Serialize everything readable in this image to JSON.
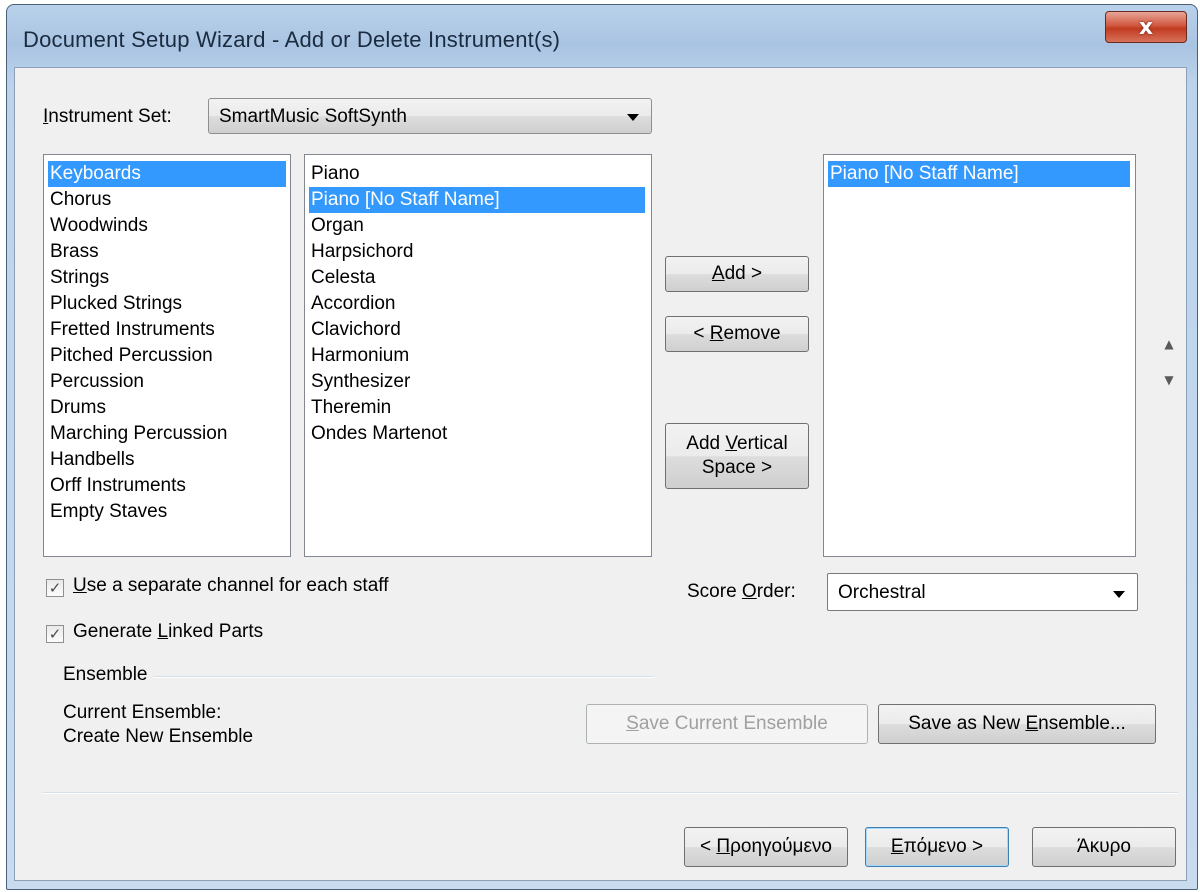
{
  "window": {
    "title": "Document Setup Wizard - Add or Delete Instrument(s)",
    "close_label": "x"
  },
  "instrument_set": {
    "label_pre": "I",
    "label_post": "nstrument Set:",
    "value": "SmartMusic SoftSynth"
  },
  "categories": [
    "Keyboards",
    "Chorus",
    "Woodwinds",
    "Brass",
    "Strings",
    "Plucked Strings",
    "Fretted Instruments",
    "Pitched Percussion",
    "Percussion",
    "Drums",
    "Marching Percussion",
    "Handbells",
    "Orff Instruments",
    "Empty Staves"
  ],
  "instruments": [
    "Piano",
    "Piano [No Staff Name]",
    "Organ",
    "Harpsichord",
    "Celesta",
    "Accordion",
    "Clavichord",
    "Harmonium",
    "Synthesizer",
    "Theremin",
    "Ondes Martenot"
  ],
  "selected": [
    "Piano [No Staff Name]"
  ],
  "buttons": {
    "add_pre": "",
    "add_u": "A",
    "add_post": "dd >",
    "remove_pre": "< ",
    "remove_u": "R",
    "remove_post": "emove",
    "vspace_line1": "Add Vertical",
    "vspace_line2": "Space >",
    "vspace_u_pre": "Add ",
    "vspace_u": "V",
    "vspace_u_post": "ertical",
    "save_current_pre": "",
    "save_current_u": "S",
    "save_current_post": "ave Current Ensemble",
    "save_new_pre": "Save as New ",
    "save_new_u": "E",
    "save_new_post": "nsemble...",
    "back_pre": "< ",
    "back_u": "Π",
    "back_post": "ροηγούμενο",
    "next_pre": "",
    "next_u": "Ε",
    "next_post": "πόμενο >",
    "cancel": "Άκυρο"
  },
  "options": {
    "separate_channel_pre": "",
    "separate_channel_u": "U",
    "separate_channel_post": "se a separate channel for each staff",
    "linked_parts_pre": "Generate ",
    "linked_parts_u": "L",
    "linked_parts_post": "inked Parts",
    "separate_channel_checked": true,
    "linked_parts_checked": true,
    "check_glyph": "✓"
  },
  "score_order": {
    "label_pre": "Score ",
    "label_u": "O",
    "label_post": "rder:",
    "value": "Orchestral"
  },
  "ensemble": {
    "heading": "Ensemble",
    "current_label": "Current Ensemble:",
    "current_value": "Create New Ensemble"
  },
  "reorder": {
    "up_glyph": "▲",
    "down_glyph": "▼"
  }
}
